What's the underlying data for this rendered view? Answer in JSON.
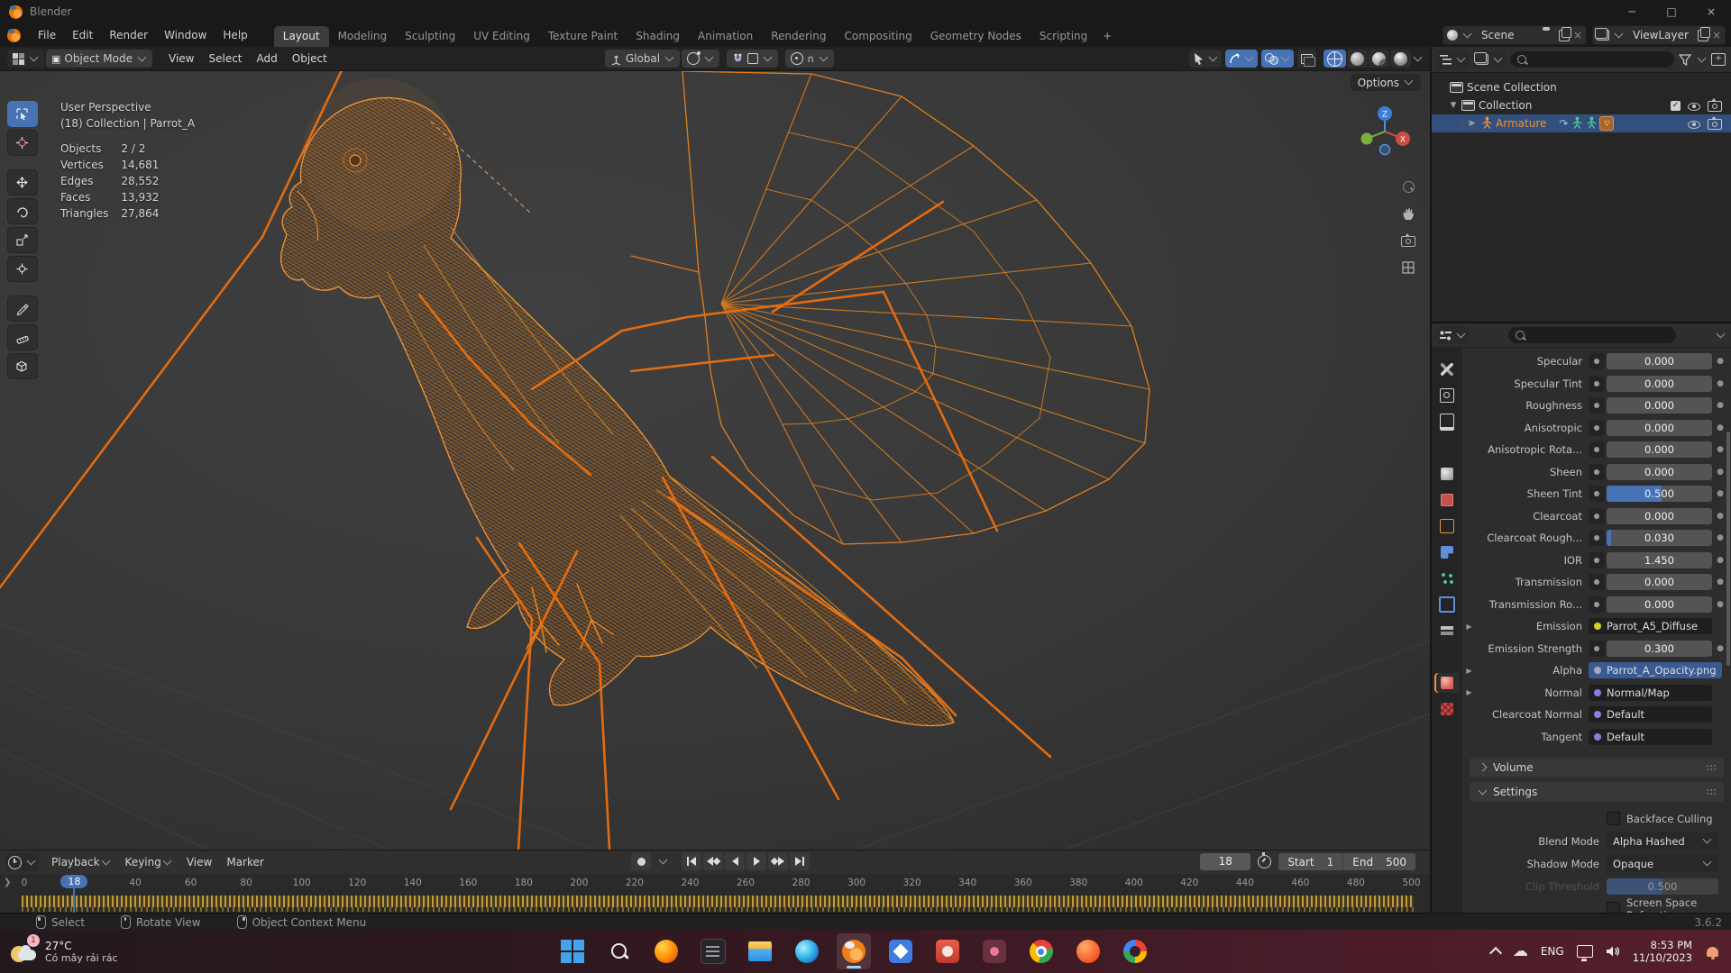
{
  "appearance": {
    "accent_blue": "#4772b3",
    "selection_orange": "#e8913c",
    "keyframe_gold": "#c9a23c",
    "wire_orange": "#f08a1d"
  },
  "window": {
    "title": "Blender"
  },
  "topbar": {
    "menus": [
      "File",
      "Edit",
      "Render",
      "Window",
      "Help"
    ],
    "tabs": [
      {
        "label": "Layout",
        "active": true
      },
      {
        "label": "Modeling"
      },
      {
        "label": "Sculpting"
      },
      {
        "label": "UV Editing"
      },
      {
        "label": "Texture Paint"
      },
      {
        "label": "Shading"
      },
      {
        "label": "Animation"
      },
      {
        "label": "Rendering"
      },
      {
        "label": "Compositing"
      },
      {
        "label": "Geometry Nodes"
      },
      {
        "label": "Scripting"
      }
    ],
    "add_tab": "+",
    "scene": {
      "label": "Scene"
    },
    "view_layer": {
      "label": "ViewLayer"
    }
  },
  "viewport": {
    "header": {
      "mode": "Object Mode",
      "menus": [
        "View",
        "Select",
        "Add",
        "Object"
      ],
      "orientation": "Global",
      "options": "Options"
    },
    "toolbar": [
      "select-box",
      "cursor",
      "move",
      "rotate",
      "scale",
      "transform",
      "annotate",
      "measure",
      "add-cube"
    ],
    "overlay": {
      "perspective": "User Perspective",
      "context": "(18) Collection | Parrot_A",
      "stats": [
        [
          "Objects",
          "2 / 2"
        ],
        [
          "Vertices",
          "14,681"
        ],
        [
          "Edges",
          "28,552"
        ],
        [
          "Faces",
          "13,932"
        ],
        [
          "Triangles",
          "27,864"
        ]
      ]
    },
    "gizmo_axes": {
      "x": "X",
      "z": "Z"
    }
  },
  "outliner": {
    "rows": [
      {
        "label": "Scene Collection",
        "icon": "collection",
        "indent": 0,
        "disclosure": "",
        "right": []
      },
      {
        "label": "Collection",
        "icon": "collection",
        "indent": 1,
        "disclosure": "▼",
        "right": [
          "checkbox",
          "eye",
          "camera"
        ]
      },
      {
        "label": "Armature",
        "icon": "armature",
        "indent": 2,
        "disclosure": "▶",
        "selected": true,
        "inline": [
          "anim-arrow",
          "pose-figure",
          "pose-figure",
          "armature-badge"
        ],
        "right": [
          "eye",
          "camera"
        ]
      }
    ]
  },
  "properties": {
    "tabs": [
      {
        "name": "tool"
      },
      {
        "name": "render"
      },
      {
        "name": "output"
      },
      {
        "name": "view-layer"
      },
      {
        "name": "scene"
      },
      {
        "name": "world"
      },
      {
        "name": "object"
      },
      {
        "name": "modifiers"
      },
      {
        "name": "particles"
      },
      {
        "name": "physics"
      },
      {
        "name": "constraints"
      },
      {
        "name": "object-data"
      },
      {
        "name": "material",
        "active": true
      },
      {
        "name": "texture"
      }
    ],
    "rows": [
      {
        "label": "Specular",
        "value": "0.000",
        "fill": 0
      },
      {
        "label": "Specular Tint",
        "value": "0.000",
        "fill": 0
      },
      {
        "label": "Roughness",
        "value": "0.000",
        "fill": 0
      },
      {
        "label": "Anisotropic",
        "value": "0.000",
        "fill": 0
      },
      {
        "label": "Anisotropic Rota...",
        "value": "0.000",
        "fill": 0
      },
      {
        "label": "Sheen",
        "value": "0.000",
        "fill": 0
      },
      {
        "label": "Sheen Tint",
        "value": "0.500",
        "fill": 52
      },
      {
        "label": "Clearcoat",
        "value": "0.000",
        "fill": 0
      },
      {
        "label": "Clearcoat Rough...",
        "value": "0.030",
        "fill": 4
      },
      {
        "label": "IOR",
        "value": "1.450",
        "fill": 0
      },
      {
        "label": "Transmission",
        "value": "0.000",
        "fill": 0
      },
      {
        "label": "Transmission Ro...",
        "value": "0.000",
        "fill": 0
      },
      {
        "label": "Emission",
        "value": "Parrot_A5_Diffuse",
        "socket": "#d7d123",
        "expand": true
      },
      {
        "label": "Emission Strength",
        "value": "0.300",
        "fill": 0
      },
      {
        "label": "Alpha",
        "value": "Parrot_A_Opacity.png",
        "socket": "#a8a8bc",
        "expand": true,
        "selected": true
      },
      {
        "label": "Normal",
        "value": "Normal/Map",
        "socket": "#8a7fdc",
        "expand": true
      },
      {
        "label": "Clearcoat Normal",
        "value": "Default",
        "socket": "#8a7fdc"
      },
      {
        "label": "Tangent",
        "value": "Default",
        "socket": "#8a7fdc"
      }
    ],
    "volume_panel": "Volume",
    "settings_panel": "Settings",
    "settings": {
      "backface": "Backface Culling",
      "blend_label": "Blend Mode",
      "blend_value": "Alpha Hashed",
      "shadow_label": "Shadow Mode",
      "shadow_value": "Opaque",
      "clip_label": "Clip Threshold",
      "clip_value": "0.500",
      "ssr": "Screen Space Refraction"
    }
  },
  "timeline": {
    "menus": [
      {
        "label": "Playback",
        "chev": true
      },
      {
        "label": "Keying",
        "chev": true
      },
      {
        "label": "View"
      },
      {
        "label": "Marker"
      }
    ],
    "current_frame": "18",
    "playhead_frame": 18,
    "start_label": "Start",
    "start_value": "1",
    "end_label": "End",
    "end_value": "500",
    "ruler_frames": [
      0,
      40,
      60,
      80,
      100,
      120,
      140,
      160,
      180,
      200,
      220,
      240,
      260,
      280,
      300,
      320,
      340,
      360,
      380,
      400,
      420,
      440,
      460,
      480,
      500
    ]
  },
  "status_bar": {
    "hints": [
      {
        "button": "left",
        "label": "Select"
      },
      {
        "button": "mid",
        "label": "Rotate View"
      },
      {
        "button": "right",
        "label": "Object Context Menu"
      }
    ],
    "version": "3.6.2"
  },
  "taskbar": {
    "weather": {
      "badge": "1",
      "temp": "27°C",
      "desc": "Có mây rải rác"
    },
    "apps": [
      {
        "name": "start"
      },
      {
        "name": "search"
      },
      {
        "name": "firefox"
      },
      {
        "name": "dark"
      },
      {
        "name": "explorer"
      },
      {
        "name": "edge"
      },
      {
        "name": "blender",
        "active": true
      },
      {
        "name": "photos"
      },
      {
        "name": "red"
      },
      {
        "name": "maroon"
      },
      {
        "name": "chrome"
      },
      {
        "name": "orange"
      },
      {
        "name": "google"
      }
    ],
    "tray": {
      "language": "ENG",
      "time": "8:53 PM",
      "date": "11/10/2023"
    }
  }
}
